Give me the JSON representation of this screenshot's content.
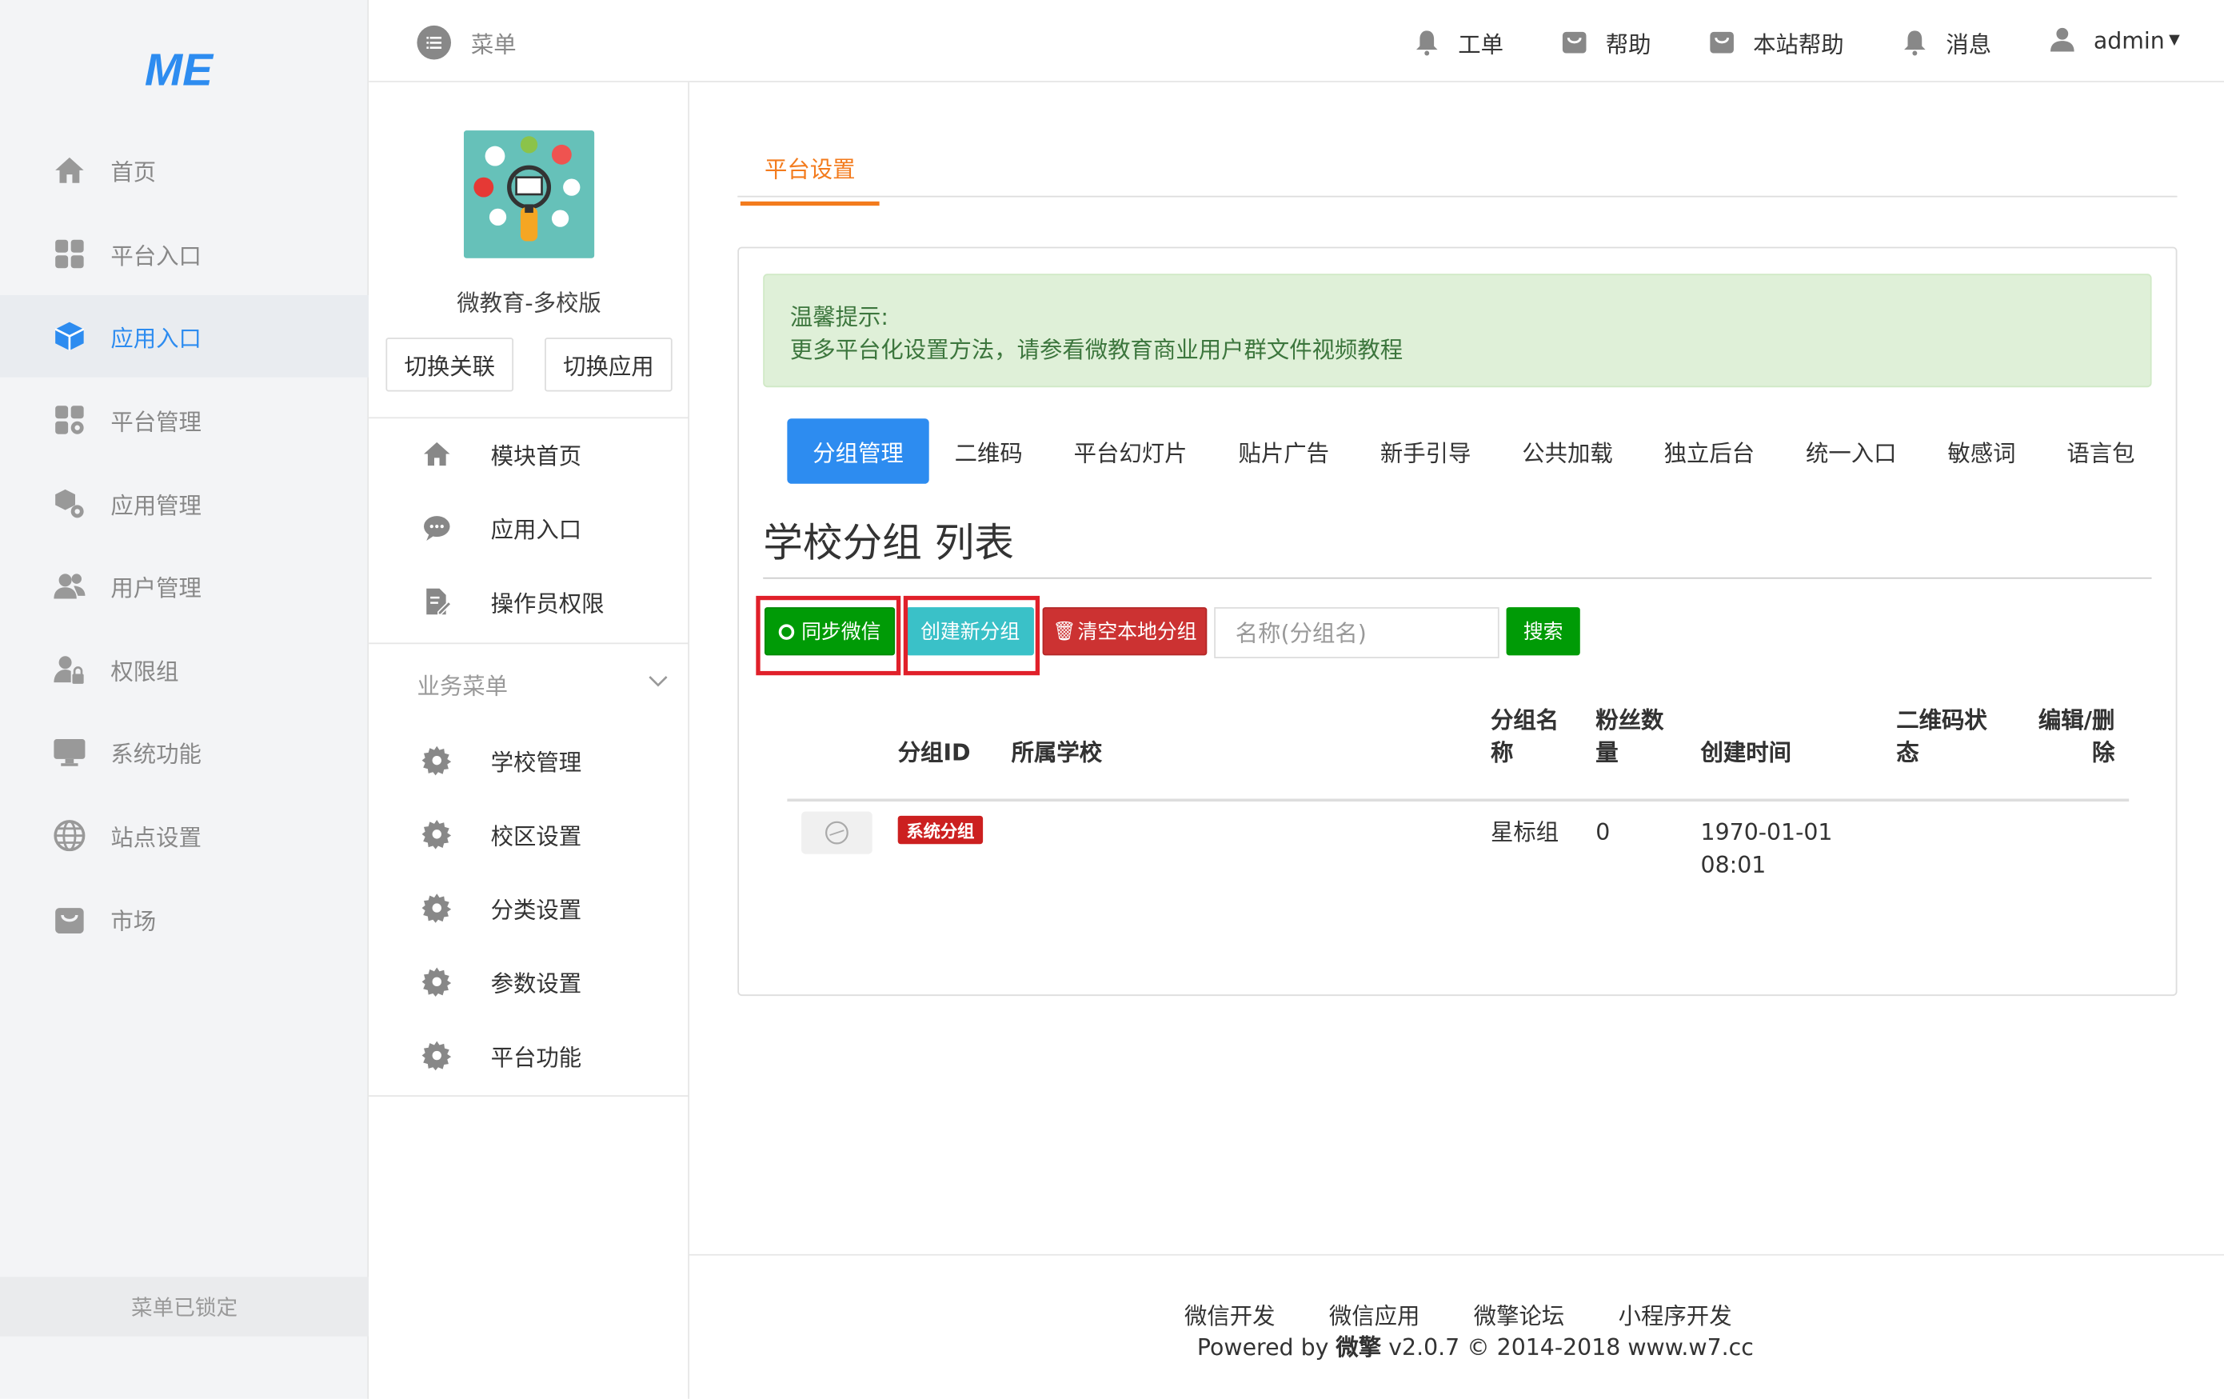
{
  "sidebar": {
    "logo_text": "ME",
    "items": [
      {
        "label": "首页",
        "icon": "home-icon"
      },
      {
        "label": "平台入口",
        "icon": "grid-icon"
      },
      {
        "label": "应用入口",
        "icon": "cube-icon",
        "active": true
      },
      {
        "label": "平台管理",
        "icon": "grid-gear-icon"
      },
      {
        "label": "应用管理",
        "icon": "cubes-gear-icon"
      },
      {
        "label": "用户管理",
        "icon": "users-icon"
      },
      {
        "label": "权限组",
        "icon": "user-lock-icon"
      },
      {
        "label": "系统功能",
        "icon": "monitor-icon"
      },
      {
        "label": "站点设置",
        "icon": "globe-icon"
      },
      {
        "label": "市场",
        "icon": "bag-icon"
      }
    ],
    "locked_label": "菜单已锁定"
  },
  "topbar": {
    "menu_label": "菜单",
    "links": [
      {
        "label": "工单",
        "icon": "bell-icon"
      },
      {
        "label": "帮助",
        "icon": "bag-icon"
      },
      {
        "label": "本站帮助",
        "icon": "bag-icon"
      },
      {
        "label": "消息",
        "icon": "bell-icon"
      },
      {
        "label": "admin",
        "icon": "user-icon"
      }
    ]
  },
  "app_panel": {
    "app_name": "微教育-多校版",
    "switch_link_label": "切换关联",
    "switch_app_label": "切换应用",
    "items": [
      {
        "label": "模块首页",
        "icon": "home-icon"
      },
      {
        "label": "应用入口",
        "icon": "chat-icon"
      },
      {
        "label": "操作员权限",
        "icon": "doc-edit-icon"
      }
    ],
    "business_menu_label": "业务菜单",
    "business_items": [
      {
        "label": "学校管理",
        "icon": "gear-icon"
      },
      {
        "label": "校区设置",
        "icon": "gear-icon"
      },
      {
        "label": "分类设置",
        "icon": "gear-icon"
      },
      {
        "label": "参数设置",
        "icon": "gear-icon"
      },
      {
        "label": "平台功能",
        "icon": "gear-icon"
      }
    ]
  },
  "main": {
    "tab_label": "平台设置",
    "alert_title": "温馨提示:",
    "alert_text": "更多平台化设置方法，请参看微教育商业用户群文件视频教程",
    "subtabs": [
      "分组管理",
      "二维码",
      "平台幻灯片",
      "贴片广告",
      "新手引导",
      "公共加载",
      "独立后台",
      "统一入口",
      "敏感词",
      "语言包"
    ],
    "list_title": "学校分组 列表",
    "sync_button": "同步微信",
    "create_button": "创建新分组",
    "clear_button": "清空本地分组",
    "search_placeholder": "名称(分组名)",
    "search_button": "搜索",
    "table": {
      "headers": {
        "group_id": "分组ID",
        "school": "所属学校",
        "group_name_1": "分组名",
        "group_name_2": "称",
        "fans_1": "粉丝数",
        "fans_2": "量",
        "created": "创建时间",
        "qr_1": "二维码状",
        "qr_2": "态",
        "edit_1": "编辑/删",
        "edit_2": "除"
      },
      "rows": [
        {
          "badge": "系统分组",
          "group_name": "星标组",
          "fans": "0",
          "created_date": "1970-01-01",
          "created_time": "08:01"
        }
      ]
    }
  },
  "footer": {
    "links": [
      "微信开发",
      "微信应用",
      "微擎论坛",
      "小程序开发"
    ],
    "powered_prefix": "Powered by ",
    "powered_brand": "微擎",
    "powered_suffix": " v2.0.7 © 2014-2018 www.w7.cc"
  },
  "colors": {
    "accent_blue": "#2d8cf0",
    "tab_orange": "#f37b1d",
    "success_green": "#009b06",
    "teal": "#3ac1c8",
    "danger_red": "#cc3232",
    "highlight_box": "#e0202a"
  }
}
